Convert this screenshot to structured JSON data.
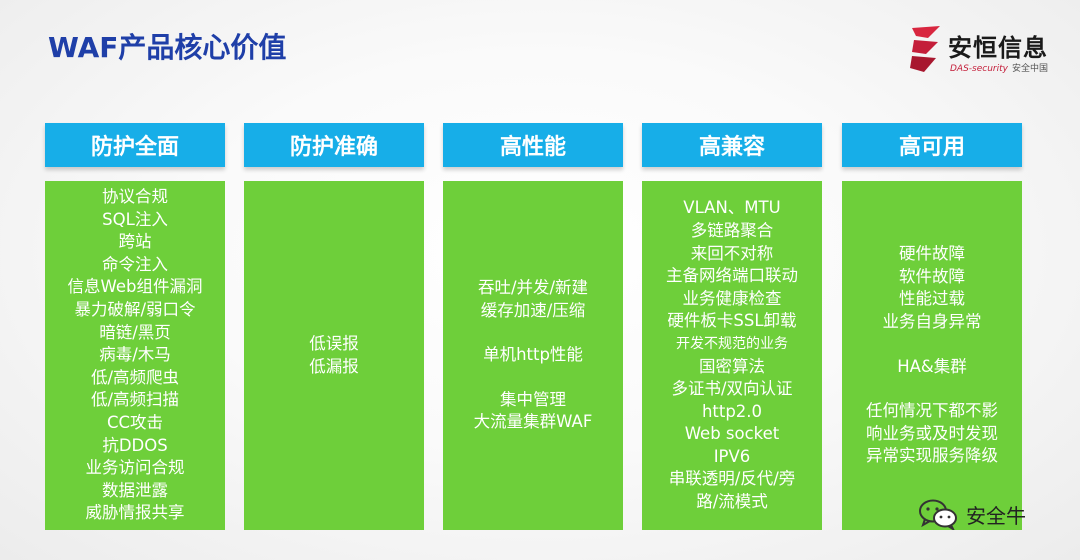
{
  "title": "WAF产品核心价值",
  "logo": {
    "cn": "安恒信息",
    "en": "DAS-security",
    "en_sub": "安全中国"
  },
  "columns": [
    {
      "header": "防护全面",
      "items": [
        "协议合规",
        "SQL注入",
        "跨站",
        "命令注入",
        "信息Web组件漏洞",
        "暴力破解/弱口令",
        "暗链/黑页",
        "病毒/木马",
        "低/高频爬虫",
        "低/高频扫描",
        "CC攻击",
        "抗DDOS",
        "业务访问合规",
        "数据泄露",
        "威胁情报共享"
      ]
    },
    {
      "header": "防护准确",
      "items": [
        "低误报",
        "低漏报"
      ]
    },
    {
      "header": "高性能",
      "items": [
        "吞吐/并发/新建",
        "缓存加速/压缩",
        "",
        "单机http性能",
        "",
        "集中管理",
        "大流量集群WAF"
      ]
    },
    {
      "header": "高兼容",
      "items": [
        "VLAN、MTU",
        "多链路聚合",
        "来回不对称",
        "主备网络端口联动",
        "业务健康检查",
        "硬件板卡SSL卸载",
        "开发不规范的业务",
        "国密算法",
        "多证书/双向认证",
        "http2.0",
        "Web socket",
        "IPV6",
        "串联透明/反代/旁",
        "路/流模式"
      ]
    },
    {
      "header": "高可用",
      "items": [
        "硬件故障",
        "软件故障",
        "性能过载",
        "业务自身异常",
        "",
        "HA&集群",
        "",
        "任何情况下都不影",
        "响业务或及时发现",
        "异常实现服务降级"
      ]
    }
  ],
  "watermark": {
    "text": "安全牛",
    "icon": "wechat-icon"
  },
  "colors": {
    "title": "#1f3fa8",
    "header_bg": "#17aee8",
    "body_bg": "#6ecf3a",
    "logo_red": "#c41e3a"
  }
}
